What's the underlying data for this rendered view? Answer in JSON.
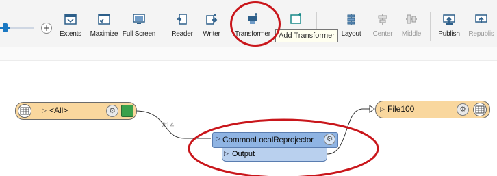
{
  "toolbar": {
    "zoom_plus": "+",
    "buttons": [
      {
        "key": "extents",
        "label": "Extents",
        "icon": "extents-icon",
        "enabled": true
      },
      {
        "key": "maximize",
        "label": "Maximize",
        "icon": "maximize-icon",
        "enabled": true
      },
      {
        "key": "full_screen",
        "label": "Full Screen",
        "icon": "full-screen-icon",
        "enabled": true
      },
      {
        "key": "reader",
        "label": "Reader",
        "icon": "reader-icon",
        "enabled": true
      },
      {
        "key": "writer",
        "label": "Writer",
        "icon": "writer-icon",
        "enabled": true
      },
      {
        "key": "transformer",
        "label": "Transformer",
        "icon": "transformer-icon",
        "enabled": true
      },
      {
        "key": "layout",
        "label": "Layout",
        "icon": "layout-icon",
        "enabled": true
      },
      {
        "key": "center",
        "label": "Center",
        "icon": "center-icon",
        "enabled": false
      },
      {
        "key": "middle",
        "label": "Middle",
        "icon": "middle-icon",
        "enabled": false
      },
      {
        "key": "publish",
        "label": "Publish",
        "icon": "publish-icon",
        "enabled": true
      },
      {
        "key": "republish",
        "label": "Republis",
        "icon": "republish-icon",
        "enabled": false
      }
    ],
    "tooltip": "Add Transformer"
  },
  "canvas": {
    "reader_node": {
      "name": "<All>"
    },
    "edge_count": "214",
    "transformer": {
      "name": "CommonLocalReprojector",
      "port": "Output"
    },
    "writer_node": {
      "name": "File100"
    }
  },
  "colors": {
    "highlight": "#c9161b",
    "reader_writer_fill": "#f9d79e",
    "transformer_fill": "#8fb4e3",
    "accent_blue": "#1a78c2"
  }
}
